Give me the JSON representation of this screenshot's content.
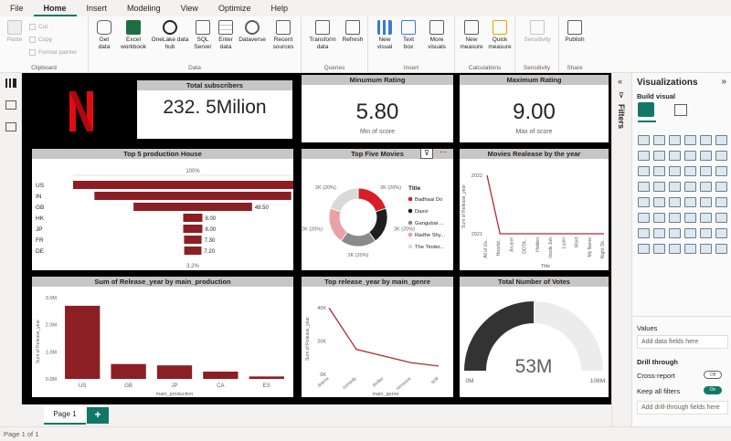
{
  "menu": [
    "File",
    "Home",
    "Insert",
    "Modeling",
    "View",
    "Optimize",
    "Help"
  ],
  "ribbon": {
    "clipboard": {
      "title": "Clipboard",
      "paste": "Paste",
      "cut": "Cut",
      "copy": "Copy",
      "format_painter": "Format painter"
    },
    "data": {
      "title": "Data",
      "buttons": [
        "Get data",
        "Excel workbook",
        "OneLake data hub",
        "SQL Server",
        "Enter data",
        "Dataverse",
        "Recent sources"
      ]
    },
    "queries": {
      "title": "Queries",
      "buttons": [
        "Transform data",
        "Refresh"
      ]
    },
    "insert": {
      "title": "Insert",
      "buttons": [
        "New visual",
        "Text box",
        "More visuals"
      ]
    },
    "calculations": {
      "title": "Calculations",
      "buttons": [
        "New measure",
        "Quick measure"
      ]
    },
    "sensitivity": {
      "title": "Sensitivity",
      "buttons": [
        "Sensitivity"
      ]
    },
    "share": {
      "title": "Share",
      "buttons": [
        "Publish"
      ]
    }
  },
  "colors": {
    "accent": "#117865",
    "bar": "#8b1f24",
    "netflix": "#e50914",
    "donut": [
      "#d81f26",
      "#1f1f1f",
      "#8a8a8a",
      "#e8a2a6",
      "#d9d9d9"
    ]
  },
  "cards": {
    "subscribers": {
      "title": "Total subscribers",
      "value": "232. 5Milion"
    },
    "min_rating": {
      "title": "Minumum Rating",
      "value": "5.80",
      "sub": "Min of score"
    },
    "max_rating": {
      "title": "Maximum Rating",
      "value": "9.00",
      "sub": "Max of score"
    }
  },
  "chart_data": [
    {
      "type": "bar",
      "title": "Top 5 production House",
      "categories": [
        "US",
        "IN",
        "GB",
        "HK",
        "JP",
        "FR",
        "DE"
      ],
      "values": [
        100,
        82.2,
        49.5,
        8.0,
        8.0,
        7.3,
        7.2
      ],
      "labels": [
        "",
        "82.20",
        "49.50",
        "8.00",
        "8.00",
        "7.30",
        "7.20"
      ],
      "top_label": "100%",
      "bottom_label": "3.2%"
    },
    {
      "type": "pie",
      "title": "Top Five Movies",
      "legend_title": "Title",
      "legend": [
        "Badhaai Do",
        "Dasvi",
        "Gangubai ...",
        "Radhe Shy...",
        "The Tinder..."
      ],
      "values": [
        20,
        20,
        20,
        20,
        20
      ],
      "slice_labels": [
        "2K (20%)",
        "2K (20%)",
        "2K (20%)",
        "2K (20%)",
        "2K (20%)"
      ]
    },
    {
      "type": "line",
      "title": "Movies Realease by the year",
      "ylabel": "Sum of Release_year",
      "xlabel": "Title",
      "yticks": [
        "2022",
        "2021"
      ],
      "categories": [
        "All of Us...",
        "Heartst...",
        "Arcane",
        "DOTA...",
        "Hidden",
        "Inside Job",
        "Lupin",
        "Maid",
        "My Name",
        "Night Sk..."
      ],
      "values": [
        2022,
        2021,
        2021,
        2021,
        2021,
        2021,
        2021,
        2021,
        2021,
        2021
      ],
      "ylim": [
        2021,
        2022
      ]
    },
    {
      "type": "bar",
      "title": "Sum of Release_year by main_production",
      "ylabel": "Sum of Release_year",
      "xlabel": "main_production",
      "categories": [
        "US",
        "GB",
        "JP",
        "CA",
        "ES"
      ],
      "values": [
        2.7,
        0.55,
        0.5,
        0.27,
        0.09
      ],
      "yticks": [
        "0.0M",
        "1.0M",
        "2.0M",
        "3.0M"
      ],
      "ylim": [
        0,
        3
      ]
    },
    {
      "type": "line",
      "title": "Top release_year by main_genre",
      "ylabel": "Sum of Release_year",
      "xlabel": "main_genre",
      "categories": [
        "drama",
        "comedy",
        "thriller",
        "romance",
        "scifi"
      ],
      "values": [
        40,
        15,
        11,
        7,
        5
      ],
      "yticks": [
        "0K",
        "20K",
        "40K"
      ],
      "ylim": [
        0,
        45
      ]
    },
    {
      "type": "gauge",
      "title": "Total Number of Votes",
      "value": 53,
      "max": 106,
      "value_label": "53M",
      "min_label": "0M",
      "max_label": "106M"
    }
  ],
  "vizpane": {
    "title": "Visualizations",
    "build": "Build visual",
    "values_label": "Values",
    "values_placeholder": "Add data fields here",
    "drill": "Drill through",
    "cross_report": "Cross-report",
    "cross_state": "Off",
    "keep_filters": "Keep all filters",
    "keep_state": "On",
    "drill_placeholder": "Add drill-through fields here"
  },
  "filters_label": "Filters",
  "page_tab": "Page 1",
  "add_page": "+",
  "status": "Page 1 of 1"
}
